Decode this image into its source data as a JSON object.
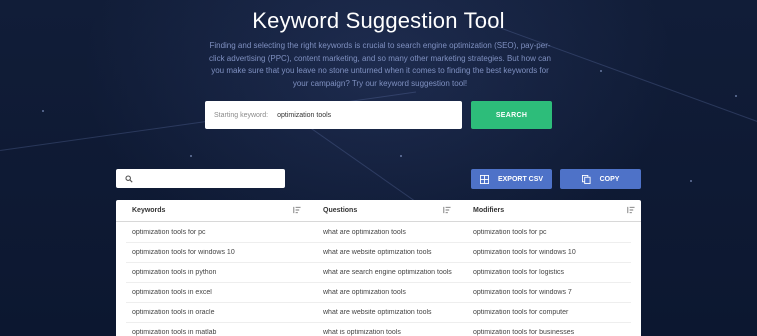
{
  "header": {
    "title": "Keyword Suggestion Tool",
    "description": "Finding and selecting the right keywords is crucial to search engine optimization (SEO), pay-per-click advertising (PPC), content marketing, and so many other marketing strategies. But how can you make sure that you leave no stone unturned when it comes to finding the best keywords for your campaign? Try our keyword suggestion tool!"
  },
  "search": {
    "label": "Starting keyword:",
    "value": "optimization tools",
    "button_label": "SEARCH"
  },
  "toolbar": {
    "filter_placeholder": "",
    "export_label": "EXPORT CSV",
    "copy_label": "COPY"
  },
  "table": {
    "columns": [
      "Keywords",
      "Questions",
      "Modifiers"
    ],
    "rows": [
      [
        "optimization tools for pc",
        "what are optimization tools",
        "optimization tools for pc"
      ],
      [
        "optimization tools for windows 10",
        "what are website optimization tools",
        "optimization tools for windows 10"
      ],
      [
        "optimization tools in python",
        "what are search engine optimization tools",
        "optimization tools for logistics"
      ],
      [
        "optimization tools in excel",
        "what are optimization tools",
        "optimization tools for windows 7"
      ],
      [
        "optimization tools in oracle",
        "what are website optimization tools",
        "optimization tools for computer"
      ],
      [
        "optimization tools in matlab",
        "what is optimization tools",
        "optimization tools for businesses"
      ]
    ]
  },
  "colors": {
    "background": "#0f1a33",
    "search_button": "#2dbd7a",
    "action_button": "#4e72c8"
  },
  "icons": {
    "filter": "search-icon",
    "export": "grid-icon",
    "copy": "copy-icon",
    "sort": "sort-icon"
  }
}
